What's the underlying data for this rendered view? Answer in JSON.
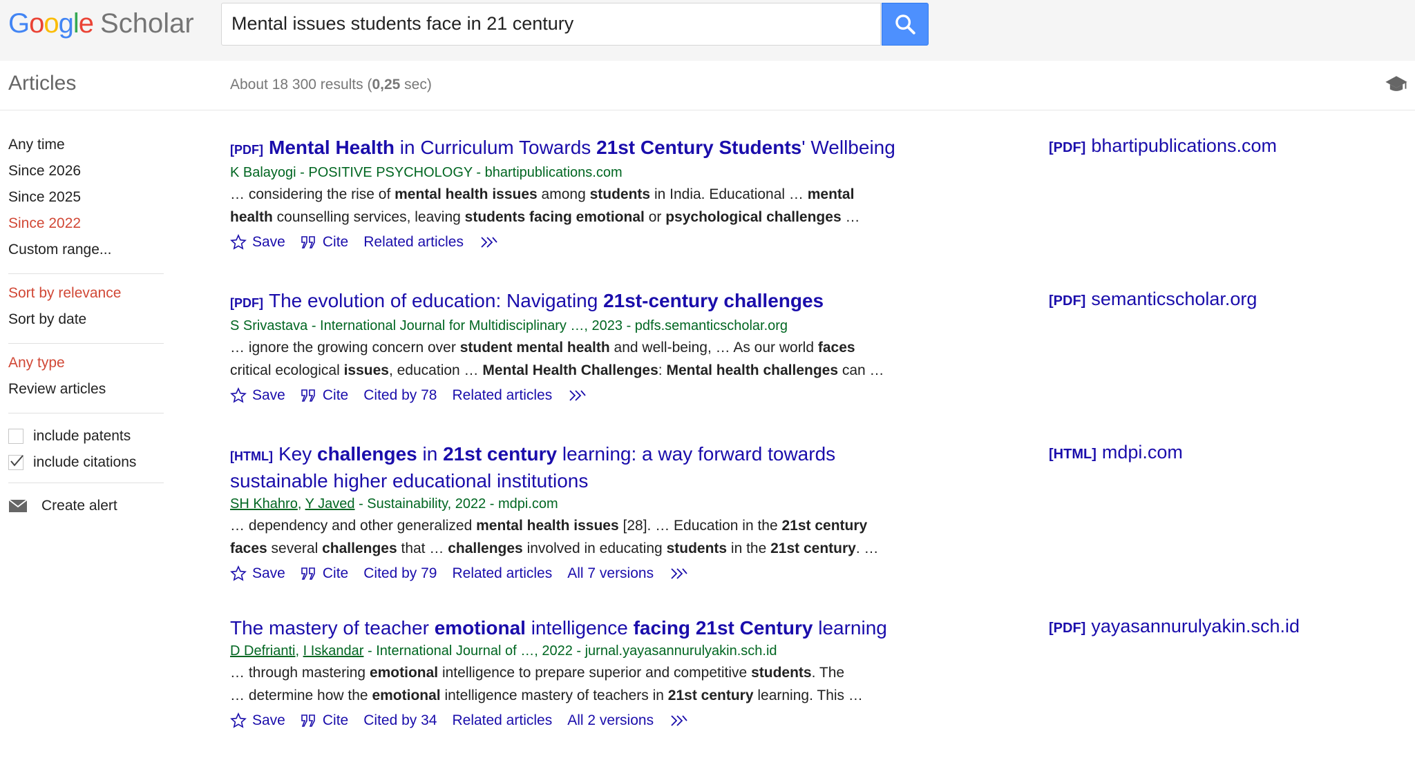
{
  "header": {
    "logo_letters": [
      "G",
      "o",
      "o",
      "g",
      "l",
      "e"
    ],
    "logo_suffix": "Scholar",
    "search_value": "Mental issues students face in 21 century"
  },
  "subheader": {
    "section_title": "Articles",
    "result_prefix": "About 18 300 results (",
    "result_time": "0,25",
    "result_suffix": " sec)"
  },
  "sidebar": {
    "time_filters": [
      "Any time",
      "Since 2026",
      "Since 2025",
      "Since 2022",
      "Custom range..."
    ],
    "time_selected": "Since 2022",
    "sort": [
      "Sort by relevance",
      "Sort by date"
    ],
    "sort_selected": "Sort by relevance",
    "types": [
      "Any type",
      "Review articles"
    ],
    "type_selected": "Any type",
    "include_patents": {
      "label": "include patents",
      "checked": false
    },
    "include_citations": {
      "label": "include citations",
      "checked": true
    },
    "create_alert": "Create alert"
  },
  "results": [
    {
      "format": "[PDF]",
      "title_parts": [
        [
          "Mental Health",
          true
        ],
        [
          " in Curriculum Towards ",
          false
        ],
        [
          "21st Century Students",
          true
        ],
        [
          "' Wellbeing",
          false
        ]
      ],
      "authors": [
        [
          "K Balayogi",
          false
        ]
      ],
      "meta_rest": " - POSITIVE PSYCHOLOGY - bhartipublications.com",
      "snippet_lines": [
        [
          [
            "… considering the rise of ",
            false
          ],
          [
            "mental health issues",
            true
          ],
          [
            " among ",
            false
          ],
          [
            "students",
            true
          ],
          [
            " in India. Educational … ",
            false
          ],
          [
            "mental",
            true
          ]
        ],
        [
          [
            "health",
            true
          ],
          [
            " counselling services, leaving ",
            false
          ],
          [
            "students facing emotional",
            true
          ],
          [
            " or ",
            false
          ],
          [
            "psychological challenges",
            true
          ],
          [
            " …",
            false
          ]
        ]
      ],
      "links": {
        "save": "Save",
        "cite": "Cite",
        "cited_by": "",
        "related": "Related articles",
        "versions": ""
      },
      "side_format": "[PDF]",
      "side_domain": "bhartipublications.com"
    },
    {
      "format": "[PDF]",
      "title_parts": [
        [
          "The evolution of education: Navigating ",
          false
        ],
        [
          "21st-century challenges",
          true
        ]
      ],
      "authors": [
        [
          "S Srivastava",
          false
        ]
      ],
      "meta_rest": " - International Journal for Multidisciplinary …, 2023 - pdfs.semanticscholar.org",
      "snippet_lines": [
        [
          [
            "… ignore the growing concern over ",
            false
          ],
          [
            "student mental health",
            true
          ],
          [
            " and well-being, … As our world ",
            false
          ],
          [
            "faces",
            true
          ]
        ],
        [
          [
            "critical ecological ",
            false
          ],
          [
            "issues",
            true
          ],
          [
            ", education … ",
            false
          ],
          [
            "Mental Health Challenges",
            true
          ],
          [
            ": ",
            false
          ],
          [
            "Mental health challenges",
            true
          ],
          [
            " can …",
            false
          ]
        ]
      ],
      "links": {
        "save": "Save",
        "cite": "Cite",
        "cited_by": "Cited by 78",
        "related": "Related articles",
        "versions": ""
      },
      "side_format": "[PDF]",
      "side_domain": "semanticscholar.org"
    },
    {
      "format": "[HTML]",
      "title_parts": [
        [
          "Key ",
          false
        ],
        [
          "challenges",
          true
        ],
        [
          " in ",
          false
        ],
        [
          "21st century",
          true
        ],
        [
          " learning: a way forward towards sustainable higher educational institutions",
          false
        ]
      ],
      "authors": [
        [
          "SH Khahro",
          true
        ],
        [
          ", ",
          false
        ],
        [
          "Y Javed",
          true
        ]
      ],
      "meta_rest": " - Sustainability, 2022 - mdpi.com",
      "snippet_lines": [
        [
          [
            "… dependency and other generalized ",
            false
          ],
          [
            "mental health issues",
            true
          ],
          [
            " [28]. … Education in the ",
            false
          ],
          [
            "21st century",
            true
          ]
        ],
        [
          [
            "faces",
            true
          ],
          [
            " several ",
            false
          ],
          [
            "challenges",
            true
          ],
          [
            " that … ",
            false
          ],
          [
            "challenges",
            true
          ],
          [
            " involved in educating ",
            false
          ],
          [
            "students",
            true
          ],
          [
            " in the ",
            false
          ],
          [
            "21st century",
            true
          ],
          [
            ". …",
            false
          ]
        ]
      ],
      "links": {
        "save": "Save",
        "cite": "Cite",
        "cited_by": "Cited by 79",
        "related": "Related articles",
        "versions": "All 7 versions"
      },
      "side_format": "[HTML]",
      "side_domain": "mdpi.com"
    },
    {
      "format": "",
      "title_parts": [
        [
          "The mastery of teacher ",
          false
        ],
        [
          "emotional",
          true
        ],
        [
          " intelligence ",
          false
        ],
        [
          "facing 21st Century",
          true
        ],
        [
          " learning",
          false
        ]
      ],
      "authors": [
        [
          "D Defrianti",
          true
        ],
        [
          ", ",
          false
        ],
        [
          "I Iskandar",
          true
        ]
      ],
      "meta_rest": " - International Journal of …, 2022 - jurnal.yayasannurulyakin.sch.id",
      "snippet_lines": [
        [
          [
            "… through mastering ",
            false
          ],
          [
            "emotional",
            true
          ],
          [
            " intelligence to prepare superior and competitive ",
            false
          ],
          [
            "students",
            true
          ],
          [
            ". The",
            false
          ]
        ],
        [
          [
            "… determine how the ",
            false
          ],
          [
            "emotional",
            true
          ],
          [
            " intelligence mastery of teachers in ",
            false
          ],
          [
            "21st century",
            true
          ],
          [
            " learning. This …",
            false
          ]
        ]
      ],
      "links": {
        "save": "Save",
        "cite": "Cite",
        "cited_by": "Cited by 34",
        "related": "Related articles",
        "versions": "All 2 versions"
      },
      "side_format": "[PDF]",
      "side_domain": "yayasannurulyakin.sch.id"
    }
  ],
  "icons": {
    "search": "search-icon",
    "library": "graduation-cap-icon",
    "star": "star-icon",
    "quote": "quote-icon",
    "more": "double-chevron-icon",
    "mail": "mail-icon",
    "check": "check-icon"
  },
  "colors": {
    "link": "#1a0dab",
    "meta_green": "#006621",
    "selected_red": "#d14836",
    "search_button": "#4d90fe"
  }
}
